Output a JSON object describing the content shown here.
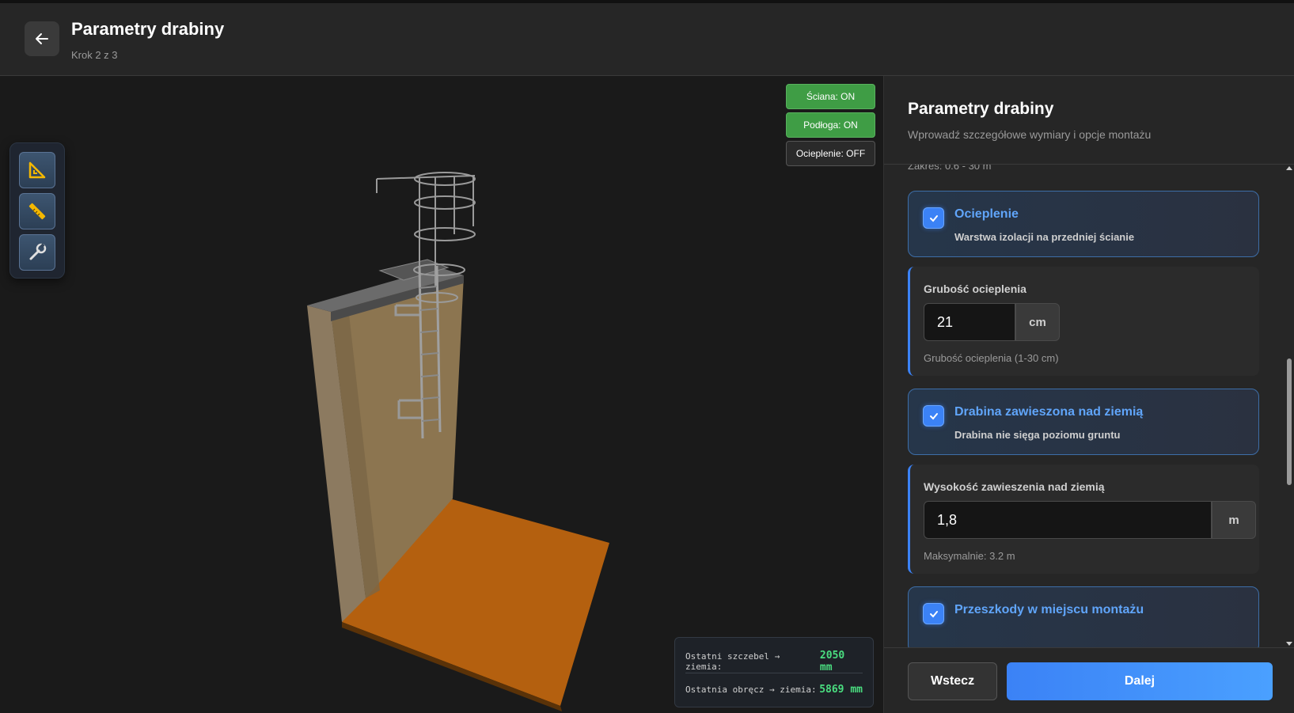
{
  "header": {
    "title": "Parametry drabiny",
    "step": "Krok 2 z 3"
  },
  "toolbar": {
    "tools": [
      "triangle-ruler-icon",
      "ruler-icon",
      "wrench-icon"
    ]
  },
  "view_toggles": [
    {
      "label": "Ściana: ON",
      "state": "on"
    },
    {
      "label": "Podłoga: ON",
      "state": "on"
    },
    {
      "label": "Ocieplenie: OFF",
      "state": "off"
    }
  ],
  "measurements": [
    {
      "label": "Ostatni szczebel → ziemia:",
      "value": "2050 mm"
    },
    {
      "label": "Ostatnia obręcz → ziemia:",
      "value": "5869 mm"
    }
  ],
  "panel": {
    "title": "Parametry drabiny",
    "subtitle": "Wprowadź szczegółowe wymiary i opcje montażu",
    "range_hint": "Zakres: 0.6 - 30 m",
    "options": [
      {
        "title": "Ocieplenie",
        "desc": "Warstwa izolacji na przedniej ścianie",
        "checked": true
      },
      {
        "title": "Drabina zawieszona nad ziemią",
        "desc": "Drabina nie sięga poziomu gruntu",
        "checked": true
      },
      {
        "title": "Przeszkody w miejscu montażu",
        "desc": "",
        "checked": true
      }
    ],
    "insulation": {
      "label": "Grubość ocieplenia",
      "value": "21",
      "unit": "cm",
      "help": "Grubość ocieplenia (1-30 cm)"
    },
    "suspension": {
      "label": "Wysokość zawieszenia nad ziemią",
      "value": "1,8",
      "unit": "m",
      "help": "Maksymalnie: 3.2 m"
    }
  },
  "footer": {
    "back_label": "Wstecz",
    "next_label": "Dalej"
  },
  "colors": {
    "accent": "#3b82f6",
    "toggle_on": "#3f9d45",
    "measure_value": "#4ade80",
    "floor": "#b8600e",
    "wall": "#8c7550"
  }
}
